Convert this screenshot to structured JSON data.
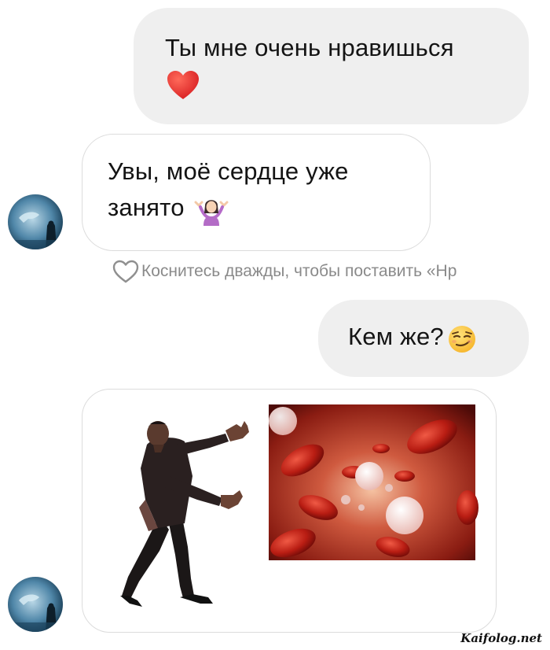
{
  "messages": {
    "m1_text": "Ты мне очень нравишься",
    "m1_emoji": "heart",
    "m2_line1": "Увы, моё сердце уже",
    "m2_line2": "занято",
    "m2_emoji": "woman-shrugging",
    "m3_text": "Кем же?",
    "m3_emoji": "smirking-face"
  },
  "like_hint": "Коснитесь дважды, чтобы поставить «Нр",
  "watermark": "Kaifolog.net",
  "colors": {
    "outgoing_bubble": "#efefef",
    "incoming_border": "#dcdcdc",
    "hint_text": "#8a8a8a",
    "heart_red": "#e0312f"
  }
}
